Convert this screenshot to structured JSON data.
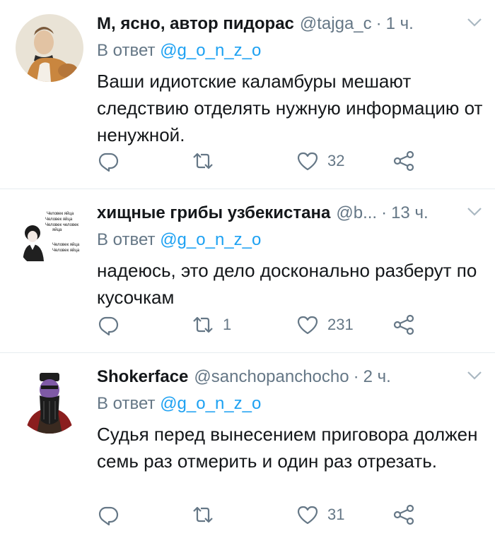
{
  "tweets": [
    {
      "name": "М, ясно, автор пидорас",
      "handle": "@tajga_c",
      "time": "1 ч.",
      "reply_prefix": "В ответ",
      "reply_to": "@g_o_n_z_o",
      "text": "Ваши идиотские каламбуры мешают следствию отделять нужную информацию от ненужной.",
      "replies": "",
      "retweets": "",
      "likes": "32"
    },
    {
      "name": "хищные грибы узбекистана",
      "handle": "@b...",
      "time": "13 ч.",
      "reply_prefix": "В ответ",
      "reply_to": "@g_o_n_z_o",
      "text": "надеюсь, это дело досконально разберут по кусочкам",
      "replies": "",
      "retweets": "1",
      "likes": "231",
      "avatar_lines": [
        "Человек яйца",
        "Человек яйца",
        "Человек человек",
        "яйца",
        "Человек яйца",
        "Человек яйца"
      ]
    },
    {
      "name": "Shokerface",
      "handle": "@sanchopanchocho",
      "time": "2 ч.",
      "reply_prefix": "В ответ",
      "reply_to": "@g_o_n_z_o",
      "text": "Судья перед вынесением приговора должен семь раз отмерить и один раз отрезать.",
      "replies": "",
      "retweets": "",
      "likes": "31"
    }
  ],
  "icons": {
    "reply": "reply-icon",
    "retweet": "retweet-icon",
    "like": "heart-icon",
    "share": "share-icon",
    "caret": "chevron-down-icon"
  },
  "colors": {
    "text": "#14171a",
    "secondary": "#657786",
    "link": "#1da1f2",
    "divider": "#e6ecf0"
  }
}
